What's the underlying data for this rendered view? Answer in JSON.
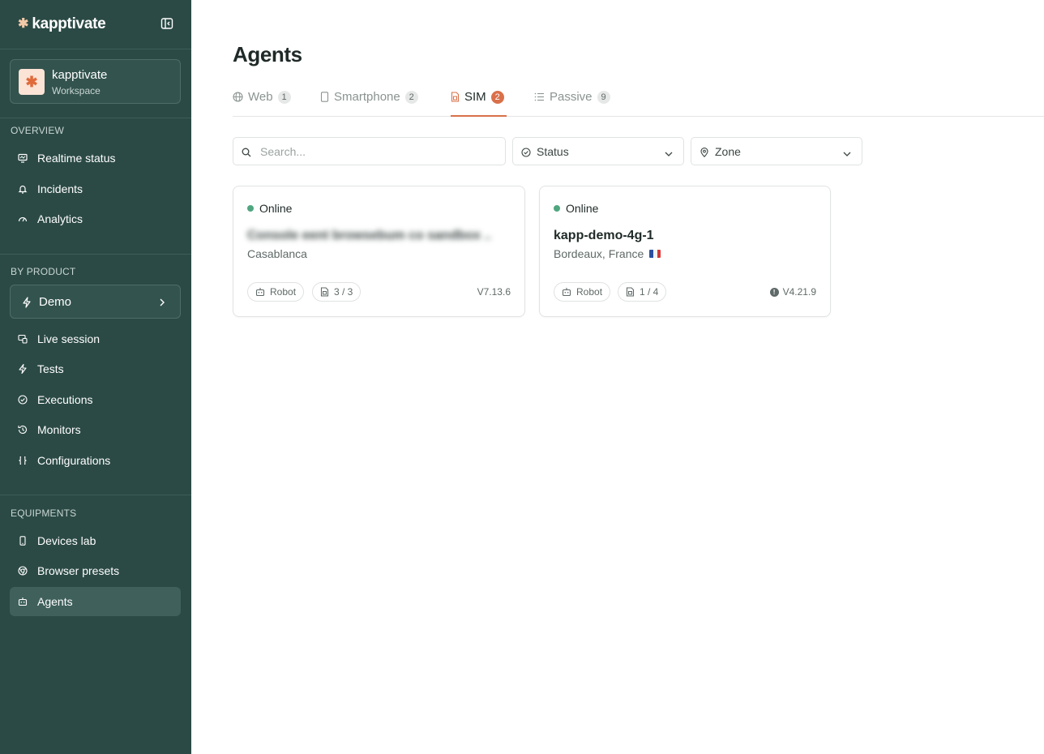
{
  "brand": {
    "name": "kapptivate",
    "mark": "✱"
  },
  "workspace": {
    "name": "kapptivate",
    "subtitle": "Workspace",
    "avatar": "✱"
  },
  "sidebar": {
    "overview_label": "OVERVIEW",
    "overview_items": [
      {
        "label": "Realtime status",
        "icon": "monitor-icon"
      },
      {
        "label": "Incidents",
        "icon": "bell-icon"
      },
      {
        "label": "Analytics",
        "icon": "gauge-icon"
      }
    ],
    "product_label": "BY PRODUCT",
    "product_select": {
      "label": "Demo",
      "icon": "bolt-icon"
    },
    "product_items": [
      {
        "label": "Live session",
        "icon": "screens-icon"
      },
      {
        "label": "Tests",
        "icon": "bolt-icon"
      },
      {
        "label": "Executions",
        "icon": "check-circle-icon"
      },
      {
        "label": "Monitors",
        "icon": "history-icon"
      },
      {
        "label": "Configurations",
        "icon": "braces-icon"
      }
    ],
    "equipments_label": "EQUIPMENTS",
    "equipment_items": [
      {
        "label": "Devices lab",
        "icon": "phone-icon"
      },
      {
        "label": "Browser presets",
        "icon": "chrome-icon"
      },
      {
        "label": "Agents",
        "icon": "robot-icon",
        "active": true
      }
    ]
  },
  "page": {
    "title": "Agents"
  },
  "tabs": [
    {
      "label": "Web",
      "count": "1",
      "icon": "globe-icon"
    },
    {
      "label": "Smartphone",
      "count": "2",
      "icon": "phone-icon"
    },
    {
      "label": "SIM",
      "count": "2",
      "icon": "sim-icon",
      "active": true
    },
    {
      "label": "Passive",
      "count": "9",
      "icon": "list-icon"
    }
  ],
  "filters": {
    "search_placeholder": "Search...",
    "status_label": "Status",
    "zone_label": "Zone"
  },
  "agents": [
    {
      "status": "Online",
      "name": "Console eent browsebum co sandbox ...",
      "location": "Casablanca",
      "type": "Robot",
      "sims": "3 / 3",
      "version": "V7.13.6"
    },
    {
      "status": "Online",
      "name": "kapp-demo-4g-1",
      "location": "Bordeaux, France",
      "type": "Robot",
      "sims": "1 / 4",
      "version": "V4.21.9"
    }
  ],
  "colors": {
    "sidebar_bg": "#2b4a45",
    "accent": "#d9704a",
    "online": "#4fa67f"
  }
}
